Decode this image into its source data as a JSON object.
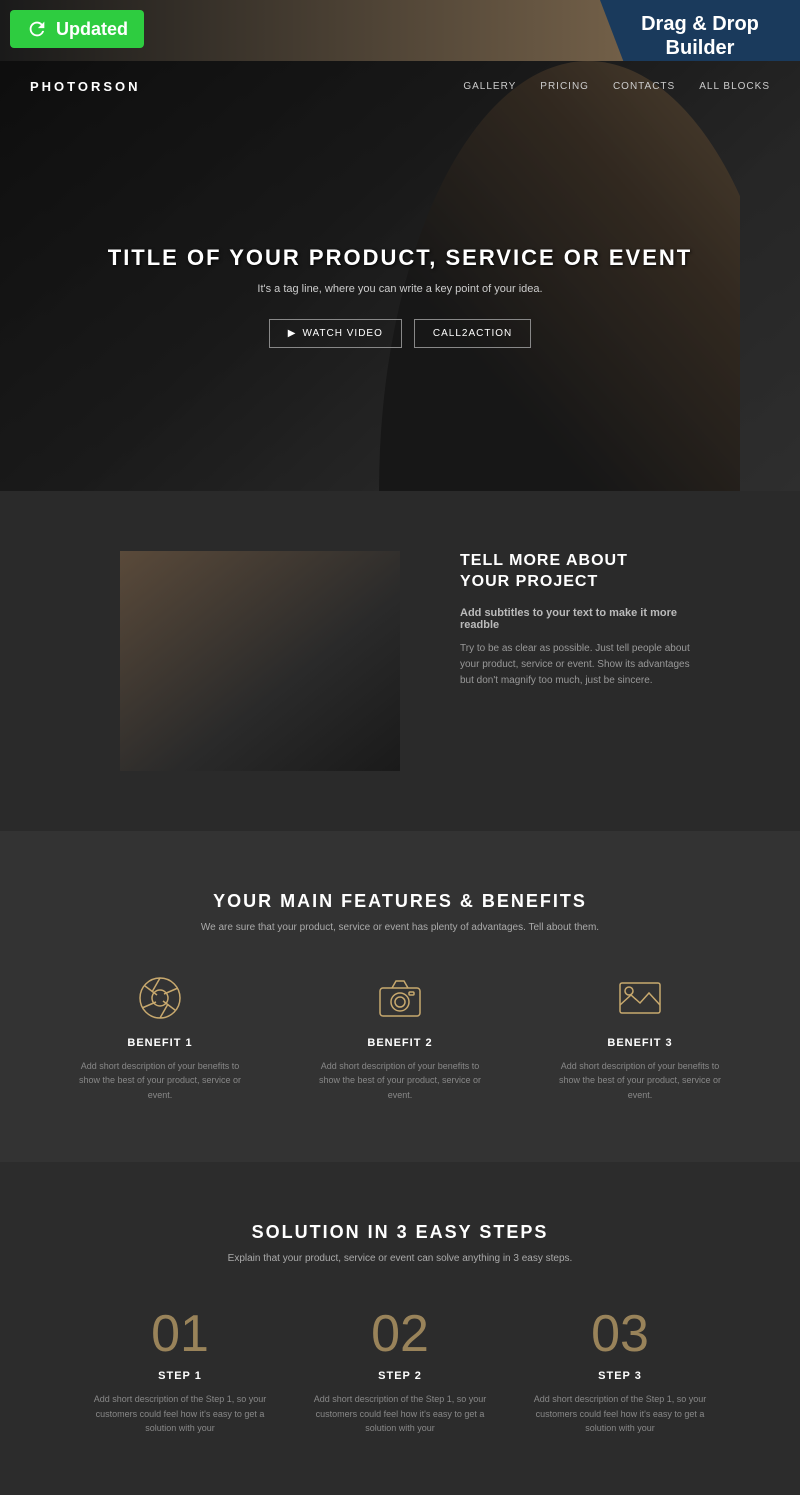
{
  "header": {
    "updated_label": "Updated",
    "dnd_label": "Drag & Drop\nBuilder"
  },
  "navbar": {
    "brand": "PHOTORSON",
    "links": [
      "GALLERY",
      "PRICING",
      "CONTACTS",
      "ALL BLOCKS"
    ]
  },
  "hero": {
    "title": "TITLE OF YOUR PRODUCT, SERVICE OR EVENT",
    "subtitle": "It's a tag line, where you can write a key point of your idea.",
    "btn_watch": "WATCH VIDEO",
    "btn_cta": "CALL2ACTION"
  },
  "about": {
    "title": "TELL MORE ABOUT\nYOUR PROJECT",
    "subtitle": "Add subtitles to your text to make it more readble",
    "desc": "Try to be as clear as possible. Just tell people about your product, service or event. Show its advantages but don't magnify too much, just be sincere."
  },
  "features": {
    "title": "YOUR MAIN FEATURES & BENEFITS",
    "subtitle": "We are sure that your product, service or event has plenty of advantages. Tell about them.",
    "items": [
      {
        "name": "BENEFIT 1",
        "desc": "Add short description of your benefits to show the best of your product, service or event."
      },
      {
        "name": "BENEFIT 2",
        "desc": "Add short description of your benefits to show the best of your product, service or event."
      },
      {
        "name": "BENEFIT 3",
        "desc": "Add short description of your benefits to show the best of your product, service or event."
      }
    ]
  },
  "steps": {
    "title": "SOLUTION IN 3 EASY STEPS",
    "subtitle": "Explain that your product, service or event can solve anything in 3 easy steps.",
    "items": [
      {
        "number": "01",
        "name": "Step 1",
        "desc": "Add short description of the Step 1, so your customers could feel how it's easy to get a solution with your"
      },
      {
        "number": "02",
        "name": "Step 2",
        "desc": "Add short description of the Step 1, so your customers could feel how it's easy to get a solution with your"
      },
      {
        "number": "03",
        "name": "Step 3",
        "desc": "Add short description of the Step 1, so your customers could feel how it's easy to get a solution with your"
      }
    ]
  }
}
